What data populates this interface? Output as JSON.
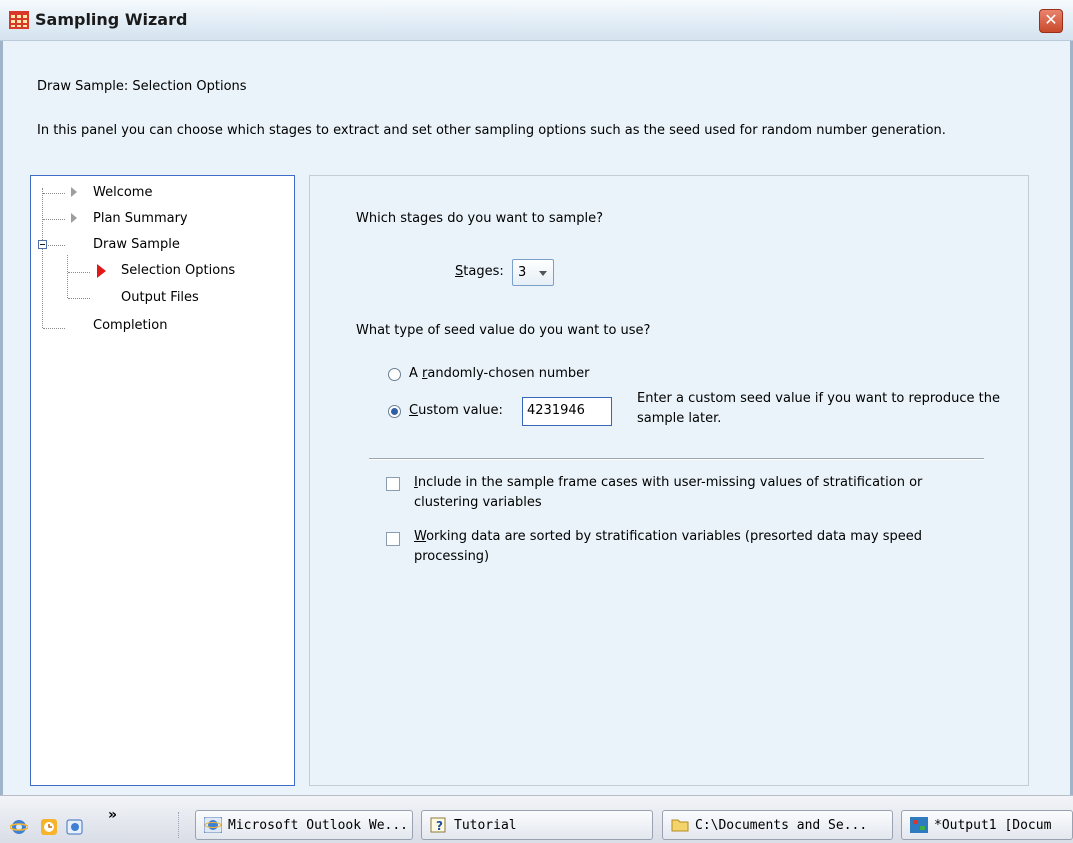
{
  "window": {
    "title": "Sampling Wizard",
    "close_symbol": "✕"
  },
  "page": {
    "heading": "Draw Sample: Selection Options",
    "description": "In this panel you can choose which stages to extract and set other sampling options such as the seed used for random number generation."
  },
  "nav": {
    "items": [
      {
        "label": "Welcome",
        "indicator": "gray-arrow-icon"
      },
      {
        "label": "Plan Summary",
        "indicator": "gray-arrow-icon"
      },
      {
        "label": "Draw Sample",
        "indicator": "collapse-icon"
      },
      {
        "label": "Selection Options",
        "indicator": "red-arrow-icon",
        "current": true
      },
      {
        "label": "Output Files",
        "indicator": "none"
      },
      {
        "label": "Completion",
        "indicator": "none"
      }
    ]
  },
  "stages": {
    "question": "Which stages do you want to sample?",
    "label_mnemonic": "S",
    "label_rest": "tages:",
    "value": "3"
  },
  "seed": {
    "question": "What type of seed value do you want to use?",
    "option_random": {
      "pre": "A ",
      "mnemonic": "r",
      "post": "andomly-chosen number",
      "selected": false
    },
    "option_custom": {
      "pre": "",
      "mnemonic": "C",
      "post": "ustom value:",
      "selected": true
    },
    "custom_value": "4231946",
    "hint": "Enter a custom seed value if you want to reproduce the sample later."
  },
  "options": {
    "include_missing": {
      "mnemonic": "I",
      "rest": "nclude in the sample frame cases with user-missing values of stratification or clustering variables",
      "checked": false
    },
    "presorted": {
      "mnemonic": "W",
      "rest": "orking data are sorted by stratification variables (presorted data may speed processing)",
      "checked": false
    }
  },
  "taskbar": {
    "overflow_symbol": "»",
    "buttons": [
      {
        "label": "Microsoft Outlook We...",
        "icon": "internet-explorer-icon"
      },
      {
        "label": "Tutorial",
        "icon": "help-icon"
      },
      {
        "label": "C:\\Documents and Se...",
        "icon": "folder-icon"
      },
      {
        "label": "*Output1 [Docum",
        "icon": "spss-output-icon"
      }
    ]
  },
  "colors": {
    "window_bg": "#e9f3f9",
    "selection_border": "#3c6ec8",
    "current_arrow": "#e01818"
  }
}
